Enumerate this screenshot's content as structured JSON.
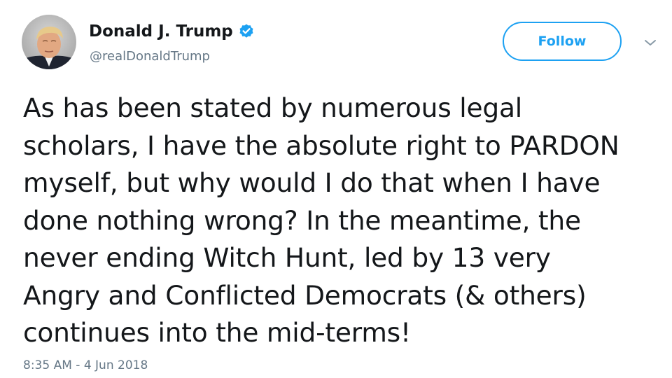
{
  "author": {
    "display_name": "Donald J. Trump",
    "handle": "@realDonaldTrump",
    "verified": true,
    "avatar_icon": "profile-photo-avatar"
  },
  "actions": {
    "follow_label": "Follow",
    "more_icon": "chevron-down-icon"
  },
  "tweet": {
    "lines": [
      "As has been stated by numerous legal",
      "scholars, I have the absolute right to PARDON",
      "myself, but why would I do that when I have",
      "done nothing wrong? In the meantime, the",
      "never ending Witch Hunt, led by 13 very",
      "Angry and Conflicted Democrats (& others)",
      "continues into the mid-terms!"
    ],
    "timestamp": "8:35 AM - 4 Jun 2018"
  },
  "colors": {
    "accent": "#1da1f2",
    "text_primary": "#14171a",
    "text_secondary": "#657786",
    "background": "#ffffff"
  }
}
